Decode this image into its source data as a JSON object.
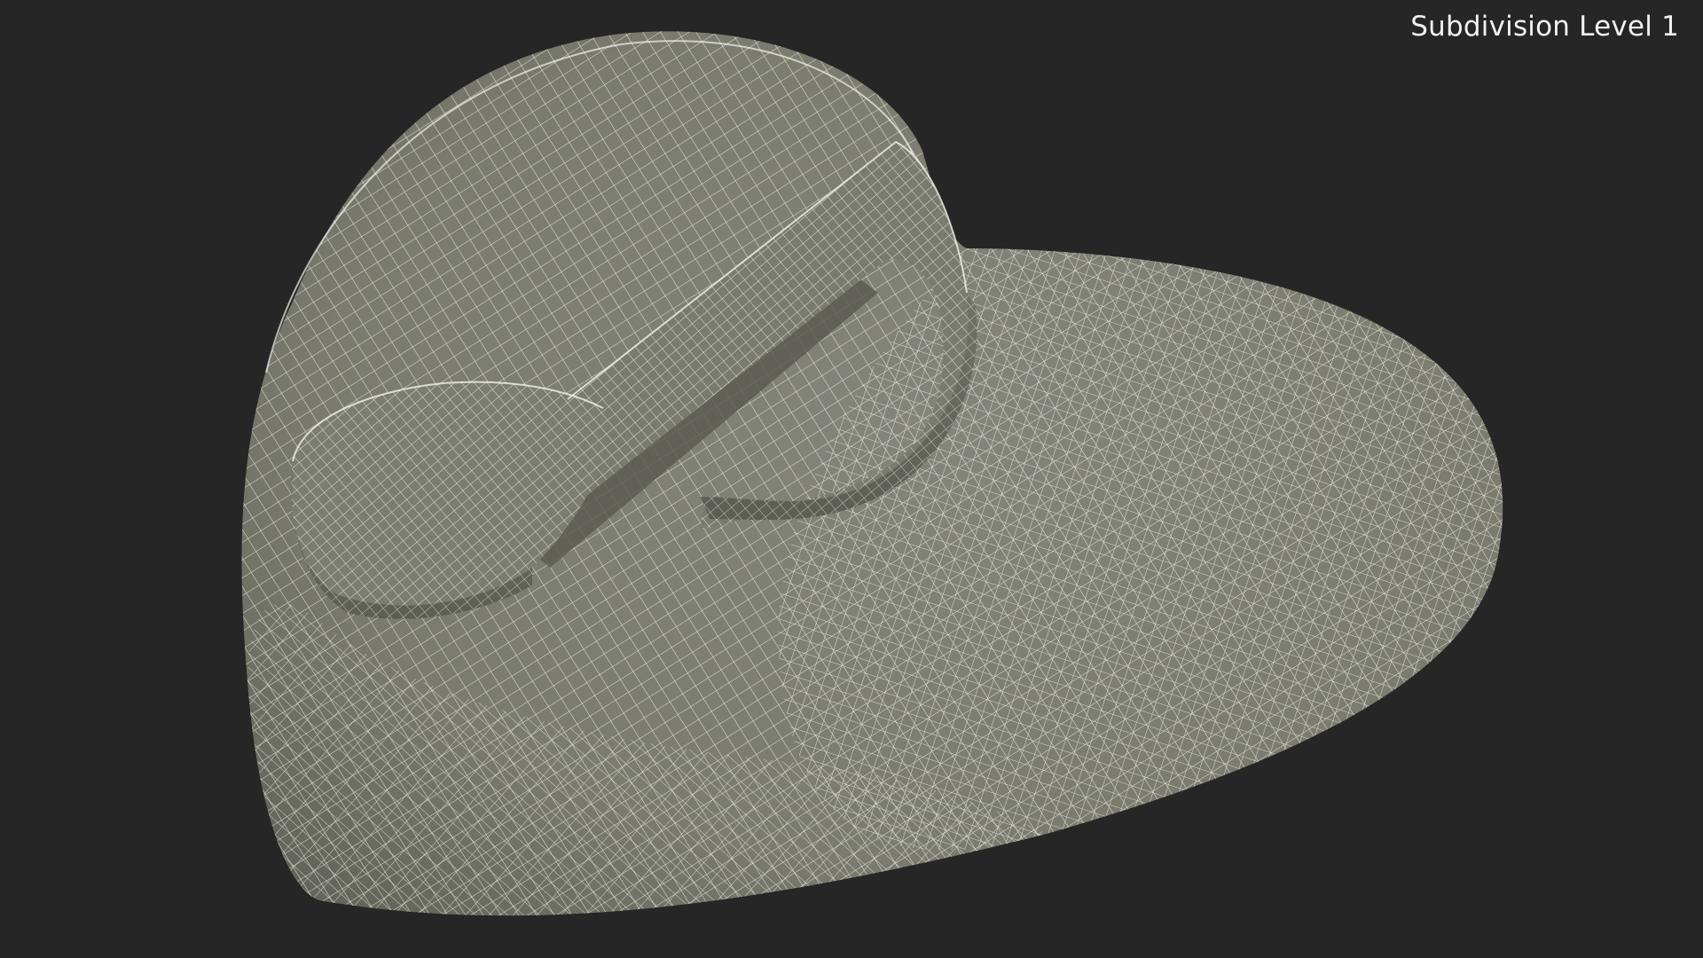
{
  "viewport": {
    "label": "Subdivision Level 1"
  },
  "colors": {
    "background": "#262626",
    "surface": "#7b7c6f",
    "surface_dark": "#5f6056",
    "surface_light": "#8a8b7e",
    "wire": "#f4f4ea",
    "label_text": "#f2f2f2"
  },
  "model": {
    "shape": "heart-with-music-note",
    "display": "wireframe-on-shaded"
  }
}
